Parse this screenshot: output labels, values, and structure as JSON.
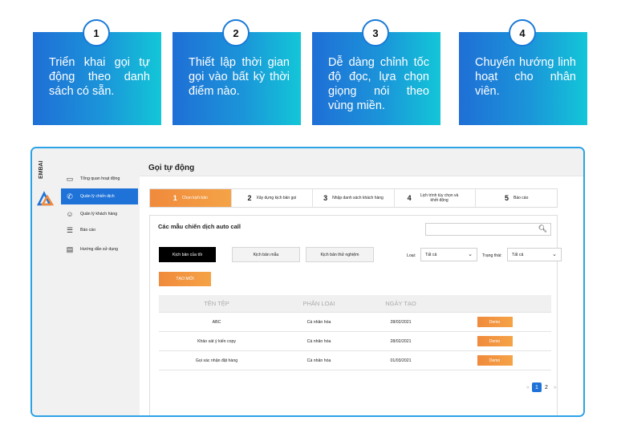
{
  "features": [
    {
      "number": "1",
      "text": "Triển khai gọi tự động theo danh sách có sẵn."
    },
    {
      "number": "2",
      "text": "Thiết lập thời gian gọi vào bất kỳ thời điểm nào."
    },
    {
      "number": "3",
      "text": "Dễ dàng chỉnh tốc độ đọc, lựa chọn giọng nói theo vùng miền."
    },
    {
      "number": "4",
      "text": "Chuyển hướng linh hoạt cho nhân viên."
    }
  ],
  "app": {
    "logo_text": "EMBAI",
    "sidebar": {
      "items": [
        {
          "label": "Tổng quan hoạt động",
          "icon": "monitor-icon"
        },
        {
          "label": "Quản lý chiến dịch",
          "icon": "phone-icon",
          "active": true
        },
        {
          "label": "Quản lý khách hàng",
          "icon": "user-icon"
        },
        {
          "label": "Báo cáo",
          "icon": "report-icon"
        },
        {
          "label": "Hướng dẫn sử dụng",
          "icon": "guide-icon"
        }
      ]
    },
    "page_title": "Gọi tự động",
    "steps": [
      {
        "number": "1",
        "label": "Chọn kịch bản"
      },
      {
        "number": "2",
        "label": "Xây dựng kịch bản gọi"
      },
      {
        "number": "3",
        "label": "Nhập danh sách khách hàng"
      },
      {
        "number": "4",
        "label": "Lịch trình tùy chọn và khởi động"
      },
      {
        "number": "5",
        "label": "Báo cáo"
      }
    ],
    "section_title": "Các mẫu chiến dịch auto call",
    "tabs": [
      "Kịch bản của tôi",
      "Kịch bản mẫu",
      "Kịch bản thử nghiệm"
    ],
    "filters": {
      "type_label": "Loại:",
      "type_value": "Tất cả",
      "status_label": "Trạng thái:",
      "status_value": "Tất cả"
    },
    "create_button": "TẠO MỚI",
    "table": {
      "headers": [
        "TÊN TỆP",
        "PHÂN LOẠI",
        "NGÀY TẠO",
        ""
      ],
      "rows": [
        {
          "name": "ABC",
          "type": "Cá nhân hóa",
          "date": "28/02/2021",
          "action": "Demo"
        },
        {
          "name": "Khảo sát ý kiến copy",
          "type": "Cá nhân hóa",
          "date": "28/02/2021",
          "action": "Demo"
        },
        {
          "name": "Gọi xác nhận đặt hàng",
          "type": "Cá nhân hóa",
          "date": "01/03/2021",
          "action": "Demo"
        }
      ]
    },
    "pagination": {
      "prev": "«",
      "pages": [
        "1",
        "2"
      ],
      "next": "»"
    }
  }
}
